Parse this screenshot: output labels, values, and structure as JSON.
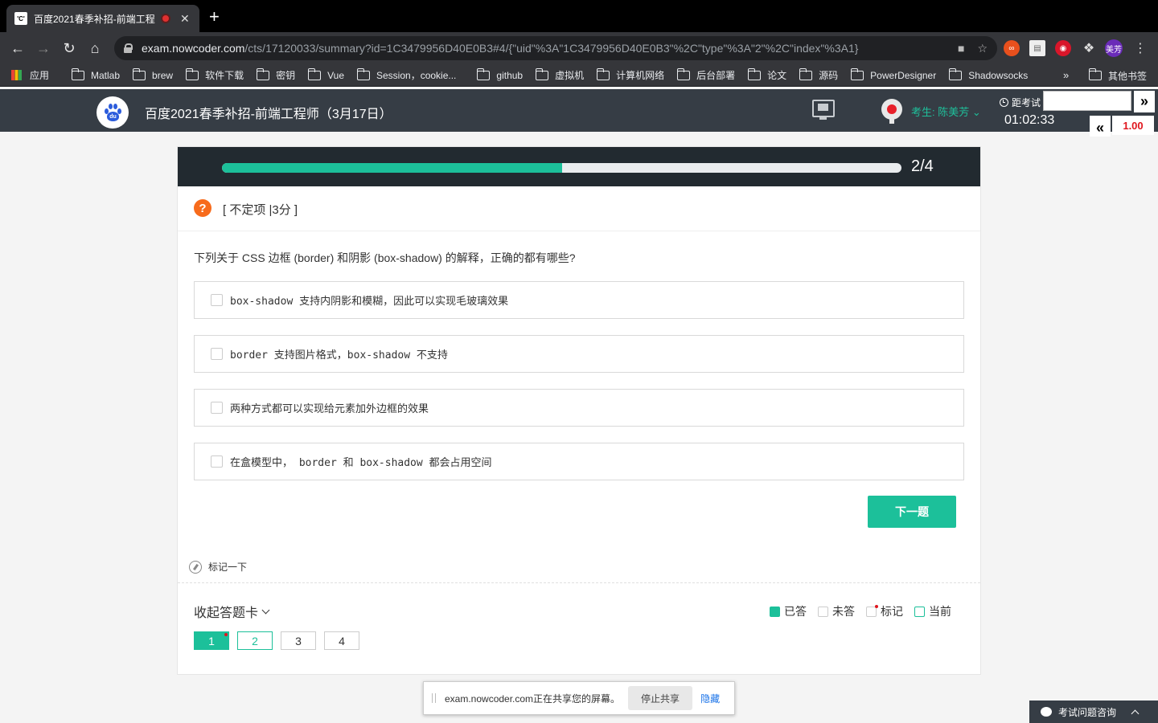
{
  "browser": {
    "tab_title": "百度2021春季补招-前端工程",
    "favicon_text": "'C'",
    "new_tab": "+",
    "close": "✕",
    "url_host": "exam.nowcoder.com",
    "url_path": "/cts/17120033/summary?id=1C3479956D40E0B3#4/{\"uid\"%3A\"1C3479956D40E0B3\"%2C\"type\"%3A\"2\"%2C\"index\"%3A1}",
    "profile": "美芳"
  },
  "bookmarks": {
    "apps": "应用",
    "items": [
      "Matlab",
      "brew",
      "软件下载",
      "密钥",
      "Vue",
      "Session，cookie...",
      "github",
      "虚拟机",
      "计算机网络",
      "后台部署",
      "论文",
      "源码",
      "PowerDesigner",
      "Shadowsocks"
    ],
    "more": "»",
    "other": "其他书签"
  },
  "header": {
    "exam_title": "百度2021春季补招-前端工程师（3月17日）",
    "candidate": "考生: 陈美芳",
    "timer_label": "距考试",
    "timer": "01:02:33",
    "zoom_next": "»",
    "zoom_prev": "«",
    "zoom_value": "1.00"
  },
  "question": {
    "progress_text": "2/4",
    "progress_fraction": 0.5,
    "icon": "?",
    "type_label": "[ 不定项 |3分 ]",
    "text": "下列关于 CSS 边框 (border) 和阴影 (box-shadow) 的解释，正确的都有哪些?",
    "options": [
      "box-shadow 支持内阴影和模糊，因此可以实现毛玻璃效果",
      "border 支持图片格式，box-shadow 不支持",
      "两种方式都可以实现给元素加外边框的效果",
      "在盒模型中， border 和 box-shadow 都会占用空间"
    ],
    "next_button": "下一题",
    "mark_label": "标记一下"
  },
  "answer_card": {
    "collapse_label": "收起答题卡",
    "legend": [
      "已答",
      "未答",
      "标记",
      "当前"
    ],
    "numbers": [
      "1",
      "2",
      "3",
      "4"
    ]
  },
  "share": {
    "text": "exam.nowcoder.com正在共享您的屏幕。",
    "stop": "停止共享",
    "hide": "隐藏"
  },
  "help": {
    "label": "考试问题咨询"
  }
}
